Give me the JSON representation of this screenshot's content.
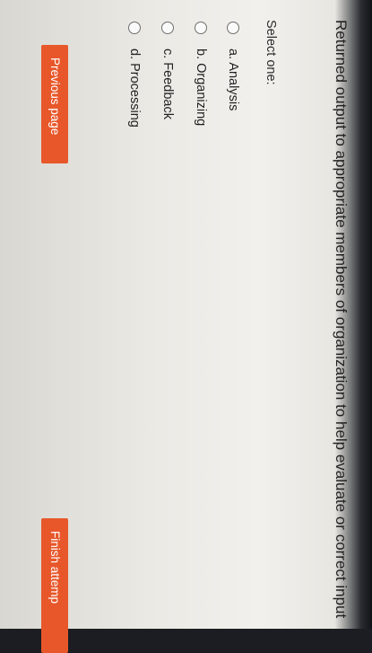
{
  "question": {
    "text": "Returned output to appropriate members of organization to help evaluate or correct input"
  },
  "answer": {
    "select_label": "Select one:",
    "options": [
      {
        "label": "a. Analysis"
      },
      {
        "label": "b. Organizing"
      },
      {
        "label": "c. Feedback"
      },
      {
        "label": "d. Processing"
      }
    ]
  },
  "navigation": {
    "previous_label": "Previous page",
    "finish_label": "Finish attemp"
  },
  "colors": {
    "button_bg": "#e8572a",
    "button_text": "#ffffff"
  }
}
